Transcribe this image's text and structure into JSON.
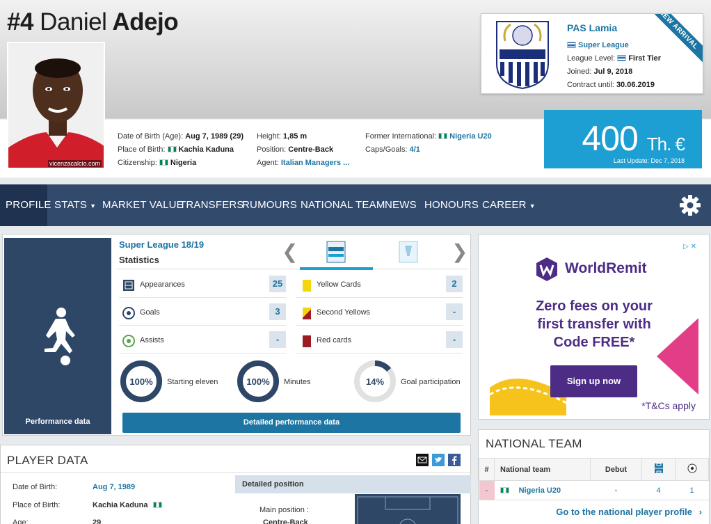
{
  "player": {
    "number": "#4",
    "first_name": "Daniel",
    "last_name": "Adejo",
    "photo_credit": "vicenzacalcio.com"
  },
  "info": {
    "dob_label": "Date of Birth (Age):",
    "dob_value": "Aug 7, 1989 (29)",
    "pob_label": "Place of Birth:",
    "pob_value": "Kachia Kaduna",
    "citizenship_label": "Citizenship:",
    "citizenship_value": "Nigeria",
    "height_label": "Height:",
    "height_value": "1,85 m",
    "position_label": "Position:",
    "position_value": "Centre-Back",
    "agent_label": "Agent:",
    "agent_value": "Italian Managers ...",
    "former_int_label": "Former International:",
    "former_int_value": "Nigeria U20",
    "caps_label": "Caps/Goals:",
    "caps_value": "4/1"
  },
  "club": {
    "name": "PAS Lamia",
    "league": "Super League",
    "level_label": "League Level:",
    "level_value": "First Tier",
    "joined_label": "Joined:",
    "joined_value": "Jul 9, 2018",
    "contract_label": "Contract until:",
    "contract_value": "30.06.2019",
    "ribbon": "NEW ARRIVAL"
  },
  "market_value": {
    "amount": "400",
    "unit": "Th. €",
    "last_update": "Last Update: Dec 7, 2018"
  },
  "nav": {
    "items": [
      "PROFILE",
      "STATS",
      "MARKET VALUE",
      "TRANSFERS",
      "RUMOURS",
      "NATIONAL TEAM",
      "NEWS",
      "HONOURS",
      "CAREER"
    ]
  },
  "stats": {
    "side_label": "Performance data",
    "season": "Super League 18/19",
    "title": "Statistics",
    "prev": "❮",
    "next": "❯",
    "rows_left": [
      {
        "label": "Appearances",
        "value": "25"
      },
      {
        "label": "Goals",
        "value": "3"
      },
      {
        "label": "Assists",
        "value": "-"
      }
    ],
    "rows_right": [
      {
        "label": "Yellow Cards",
        "value": "2"
      },
      {
        "label": "Second Yellows",
        "value": "-"
      },
      {
        "label": "Red cards",
        "value": "-"
      }
    ],
    "gauges": [
      {
        "value": "100%",
        "label": "Starting eleven",
        "fraction": 1.0
      },
      {
        "value": "100%",
        "label": "Minutes",
        "fraction": 1.0
      },
      {
        "value": "14%",
        "label": "Goal participation",
        "fraction": 0.14
      }
    ],
    "button": "Detailed performance data"
  },
  "ad": {
    "choices": "▷ ✕",
    "brand": "WorldRemit",
    "headline_1": "Zero fees on your",
    "headline_2": "first transfer with",
    "headline_3": "Code FREE*",
    "cta": "Sign up now",
    "tc": "*T&Cs apply"
  },
  "national_team": {
    "title": "NATIONAL TEAM",
    "col_rank": "#",
    "col_team": "National team",
    "col_debut": "Debut",
    "row": {
      "rank": "-",
      "team": "Nigeria U20",
      "debut": "-",
      "apps": "4",
      "goals": "1"
    },
    "link": "Go to the national player profile"
  },
  "player_data": {
    "title": "PLAYER DATA",
    "dob_label": "Date of Birth:",
    "dob_value": "Aug 7, 1989",
    "pob_label": "Place of Birth:",
    "pob_value": "Kachia Kaduna",
    "age_label": "Age:",
    "age_value": "29",
    "detailed_position": "Detailed position",
    "main_position_label": "Main position :",
    "main_position_value": "Centre-Back"
  },
  "colors": {
    "nav": "#324a6c",
    "accent": "#1d75a3",
    "market_value_bg": "#1d9fd3"
  }
}
